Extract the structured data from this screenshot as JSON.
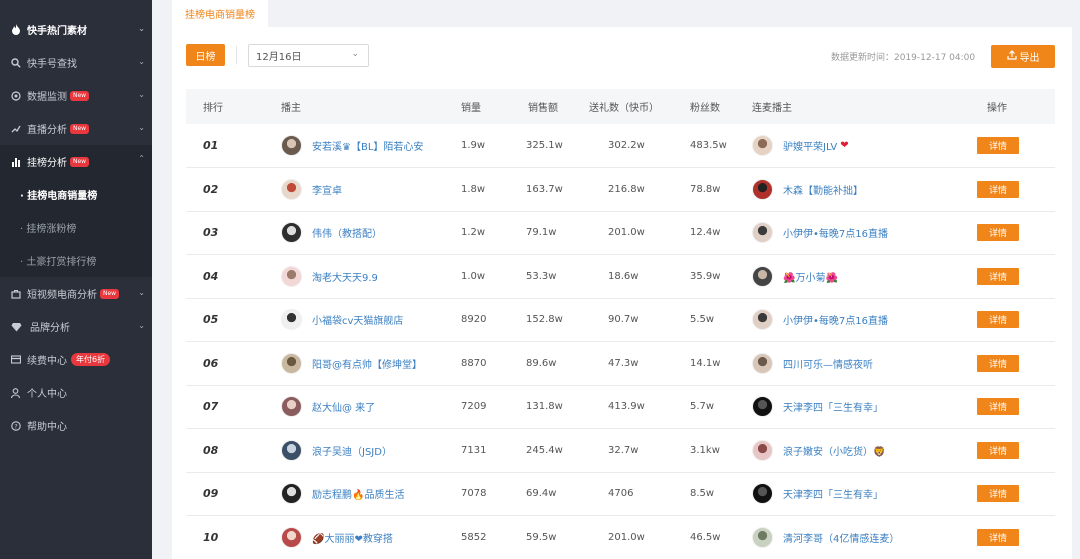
{
  "sidebar": {
    "items": [
      {
        "label": "快手热门素材",
        "icon": "flame-icon",
        "bold": true
      },
      {
        "label": "快手号查找",
        "icon": "search-icon"
      },
      {
        "label": "数据监测",
        "icon": "monitor-icon",
        "badge": "New"
      },
      {
        "label": "直播分析",
        "icon": "trend-icon",
        "badge": "New"
      },
      {
        "label": "挂榜分析",
        "icon": "bar-chart-icon",
        "badge": "New"
      },
      {
        "label": "短视频电商分析",
        "icon": "briefcase-icon",
        "badge": "New"
      },
      {
        "label": "品牌分析",
        "icon": "diamond-icon"
      },
      {
        "label": "续费中心",
        "icon": "card-icon",
        "badge": "年付6折"
      },
      {
        "label": "个人中心",
        "icon": "user-icon"
      },
      {
        "label": "帮助中心",
        "icon": "help-icon"
      }
    ],
    "subitems": [
      {
        "label": "· 挂榜电商销量榜"
      },
      {
        "label": "· 挂榜涨粉榜"
      },
      {
        "label": "· 土豪打赏排行榜"
      }
    ]
  },
  "tab": {
    "label": "挂榜电商销量榜"
  },
  "toolbar": {
    "day_label": "日榜",
    "date_value": "12月16日",
    "updated": "数据更新时间：2019-12-17 04:00",
    "export_label": "导出"
  },
  "colors": {
    "accent": "#f08519",
    "sidebar_bg": "#2b2f3a",
    "link": "#3a7fc1",
    "badge": "#e8383d"
  },
  "table": {
    "headers": [
      "排行",
      "播主",
      "销量",
      "销售额",
      "送礼数（快币）",
      "粉丝数",
      "连麦播主",
      "操作"
    ],
    "rows": [
      {
        "rank": "01",
        "host": "安若溪♛【BL】陌若心安",
        "sales": "1.9w",
        "revenue": "325.1w",
        "gifts": "302.2w",
        "fans": "483.5w",
        "partner": "驴嫂平荣JLV",
        "partner_heart": "❤",
        "action": "详情"
      },
      {
        "rank": "02",
        "host": "李宣卓",
        "sales": "1.8w",
        "revenue": "163.7w",
        "gifts": "216.8w",
        "fans": "78.8w",
        "partner": "木森【勤能补拙】",
        "partner_heart": "",
        "action": "详情"
      },
      {
        "rank": "03",
        "host": "伟伟（教搭配）",
        "sales": "1.2w",
        "revenue": "79.1w",
        "gifts": "201.0w",
        "fans": "12.4w",
        "partner": "小伊伊•每晚7点16直播",
        "partner_heart": "",
        "action": "详情"
      },
      {
        "rank": "04",
        "host": "淘老大天天9.9",
        "sales": "1.0w",
        "revenue": "53.3w",
        "gifts": "18.6w",
        "fans": "35.9w",
        "partner": "🌺万小菊🌺",
        "partner_heart": "",
        "action": "详情"
      },
      {
        "rank": "05",
        "host": "小福袋cv天猫旗舰店",
        "sales": "8920",
        "revenue": "152.8w",
        "gifts": "90.7w",
        "fans": "5.5w",
        "partner": "小伊伊•每晚7点16直播",
        "partner_heart": "",
        "action": "详情"
      },
      {
        "rank": "06",
        "host": "阳哥@有点帅【修坤堂】",
        "sales": "8870",
        "revenue": "89.6w",
        "gifts": "47.3w",
        "fans": "14.1w",
        "partner": "四川可乐—情感夜听",
        "partner_heart": "",
        "action": "详情"
      },
      {
        "rank": "07",
        "host": "赵大仙@ 来了",
        "sales": "7209",
        "revenue": "131.8w",
        "gifts": "413.9w",
        "fans": "5.7w",
        "partner": "天津李四「三生有幸」",
        "partner_heart": "",
        "action": "详情"
      },
      {
        "rank": "08",
        "host": "浪子吴迪（JSJD）",
        "sales": "7131",
        "revenue": "245.4w",
        "gifts": "32.7w",
        "fans": "3.1kw",
        "partner": "浪子嫩安（小吃货）🦁",
        "partner_heart": "",
        "action": "详情"
      },
      {
        "rank": "09",
        "host": "励志程鹏🔥品质生活",
        "sales": "7078",
        "revenue": "69.4w",
        "gifts": "4706",
        "fans": "8.5w",
        "partner": "天津李四「三生有幸」",
        "partner_heart": "",
        "action": "详情"
      },
      {
        "rank": "10",
        "host": "🏈大丽丽❤教穿搭",
        "sales": "5852",
        "revenue": "59.5w",
        "gifts": "201.0w",
        "fans": "46.5w",
        "partner": "清河李哥（4亿情感连麦）",
        "partner_heart": "",
        "action": "详情"
      }
    ]
  }
}
